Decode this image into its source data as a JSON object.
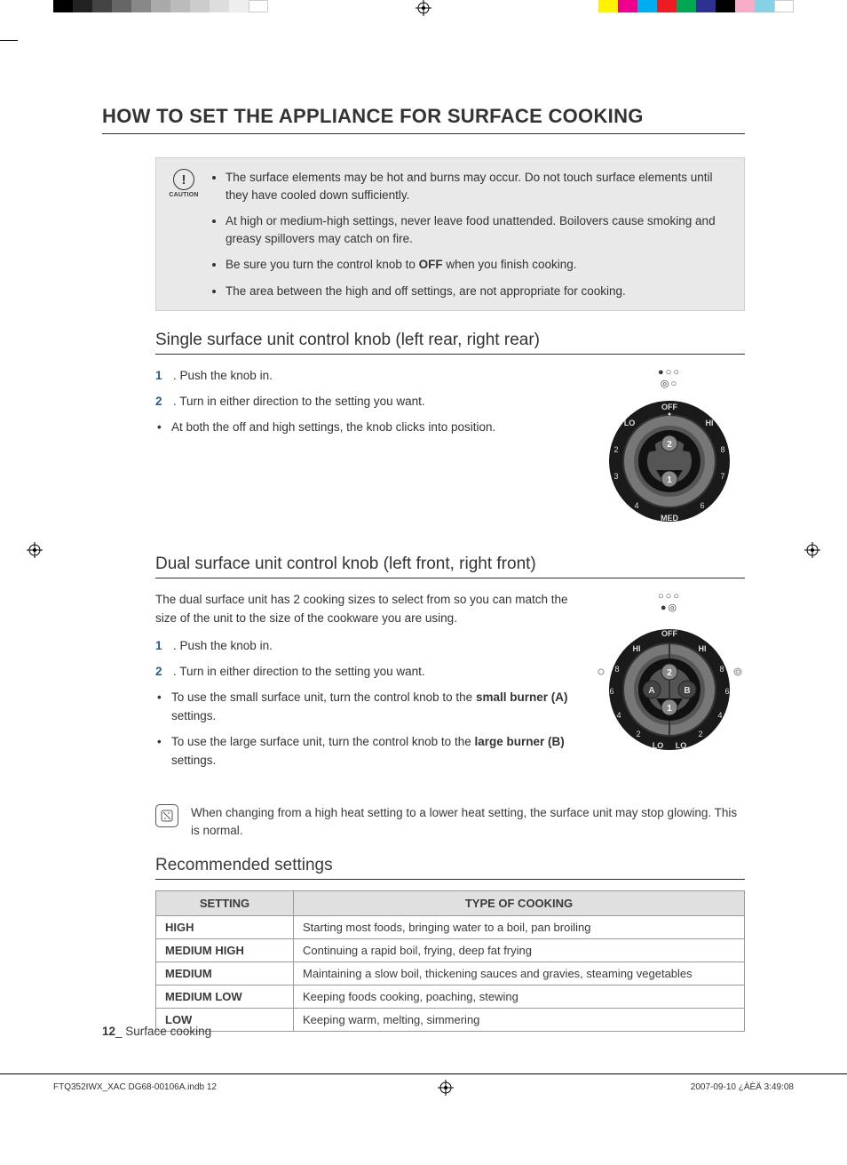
{
  "title": "HOW TO SET THE APPLIANCE FOR SURFACE COOKING",
  "caution": {
    "label": "CAUTION",
    "items": [
      "The surface elements may be hot and burns may occur. Do not touch surface elements until they have cooled down sufficiently.",
      "At high or medium-high settings, never leave food unattended. Boilovers cause smoking and greasy spillovers may catch on fire.",
      "Be sure you turn the control knob to <b>OFF</b> when you finish cooking.",
      "The area between the high and off settings,  are not appropriate for cooking."
    ]
  },
  "single": {
    "heading": "Single surface unit control knob (left rear, right rear)",
    "step1_num": "1",
    "step1_text": ".   Push the knob in.",
    "step2_num": "2",
    "step2_text": ".   Turn in either direction to the setting you want.",
    "bullet": "At both the off and high settings, the knob clicks into position.",
    "knob": {
      "off": "OFF",
      "med": "MED",
      "lo": "LO",
      "hi": "HI",
      "n2": "2",
      "n3": "3",
      "n4": "4",
      "n6": "6",
      "n7": "7",
      "n8": "8"
    }
  },
  "dual": {
    "heading": "Dual surface unit control knob (left front, right front)",
    "intro": "The dual surface unit has 2 cooking sizes to select from so you can match the size of the unit to the size of the cookware you are using.",
    "step1_num": "1",
    "step1_text": ".   Push the knob in.",
    "step2_num": "2",
    "step2_text": ".   Turn in either direction to the setting you want.",
    "bullet_a_pre": "To use the small surface unit, turn the control knob to the ",
    "bullet_a_bold": "small burner (A)",
    "bullet_a_post": " settings.",
    "bullet_b_pre": "To use the large surface unit, turn the control knob to the ",
    "bullet_b_bold": "large burner (B)",
    "bullet_b_post": " settings.",
    "knob": {
      "off": "OFF",
      "hi": "HI",
      "lo": "LO",
      "a": "A",
      "b": "B",
      "n8": "8",
      "n6": "6",
      "n4": "4",
      "n2": "2"
    }
  },
  "note": "When changing from a high heat setting to a lower heat setting, the surface unit may stop glowing. This is normal.",
  "recommended": {
    "heading": "Recommended settings",
    "col1": "SETTING",
    "col2": "TYPE OF COOKING",
    "rows": [
      {
        "s": "HIGH",
        "t": "Starting most foods, bringing water to a boil, pan broiling"
      },
      {
        "s": "MEDIUM HIGH",
        "t": "Continuing a rapid boil, frying, deep fat frying"
      },
      {
        "s": "MEDIUM",
        "t": "Maintaining a slow boil, thickening sauces and gravies, steaming vegetables"
      },
      {
        "s": "MEDIUM LOW",
        "t": "Keeping foods cooking, poaching, stewing"
      },
      {
        "s": "LOW",
        "t": "Keeping warm, melting, simmering"
      }
    ]
  },
  "footer": {
    "page": "12",
    "section": "_ Surface cooking"
  },
  "print": {
    "file": "FTQ352IWX_XAC DG68-00106A.indb   12",
    "date": "2007-09-10   ¿ÀÈÄ 3:49:08"
  }
}
